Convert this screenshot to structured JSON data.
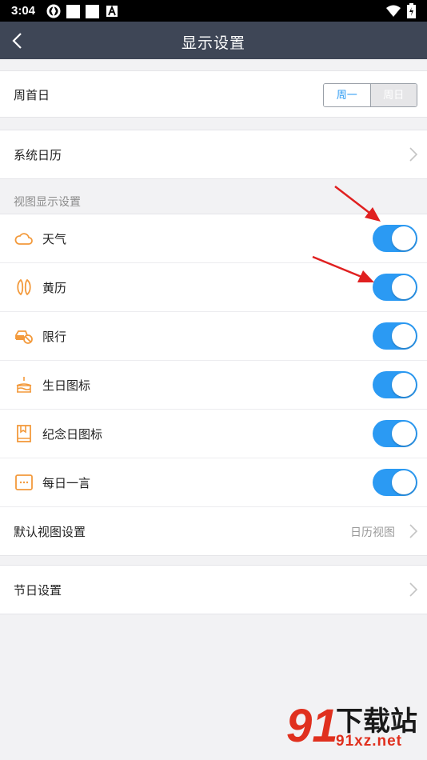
{
  "status_bar": {
    "time": "3:04"
  },
  "nav": {
    "title": "显示设置"
  },
  "week_start": {
    "label": "周首日",
    "option_monday": "周一",
    "option_sunday": "周日"
  },
  "system_calendar": {
    "label": "系统日历"
  },
  "view_section": {
    "header": "视图显示设置",
    "items": [
      {
        "label": "天气",
        "icon": "cloud-icon",
        "enabled": true
      },
      {
        "label": "黄历",
        "icon": "almanac-icon",
        "enabled": true
      },
      {
        "label": "限行",
        "icon": "traffic-restriction-icon",
        "enabled": true
      },
      {
        "label": "生日图标",
        "icon": "cake-icon",
        "enabled": true
      },
      {
        "label": "纪念日图标",
        "icon": "book-icon",
        "enabled": true
      },
      {
        "label": "每日一言",
        "icon": "quote-icon",
        "enabled": true
      }
    ]
  },
  "default_view": {
    "label": "默认视图设置",
    "value": "日历视图"
  },
  "holiday": {
    "label": "节日设置"
  },
  "watermark": {
    "top": "下载站",
    "bottom": "91xz.net"
  },
  "colors": {
    "nav": "#3e4656",
    "accent": "#2b9af3",
    "icon": "#f39a3c",
    "annotation": "#e02020"
  }
}
